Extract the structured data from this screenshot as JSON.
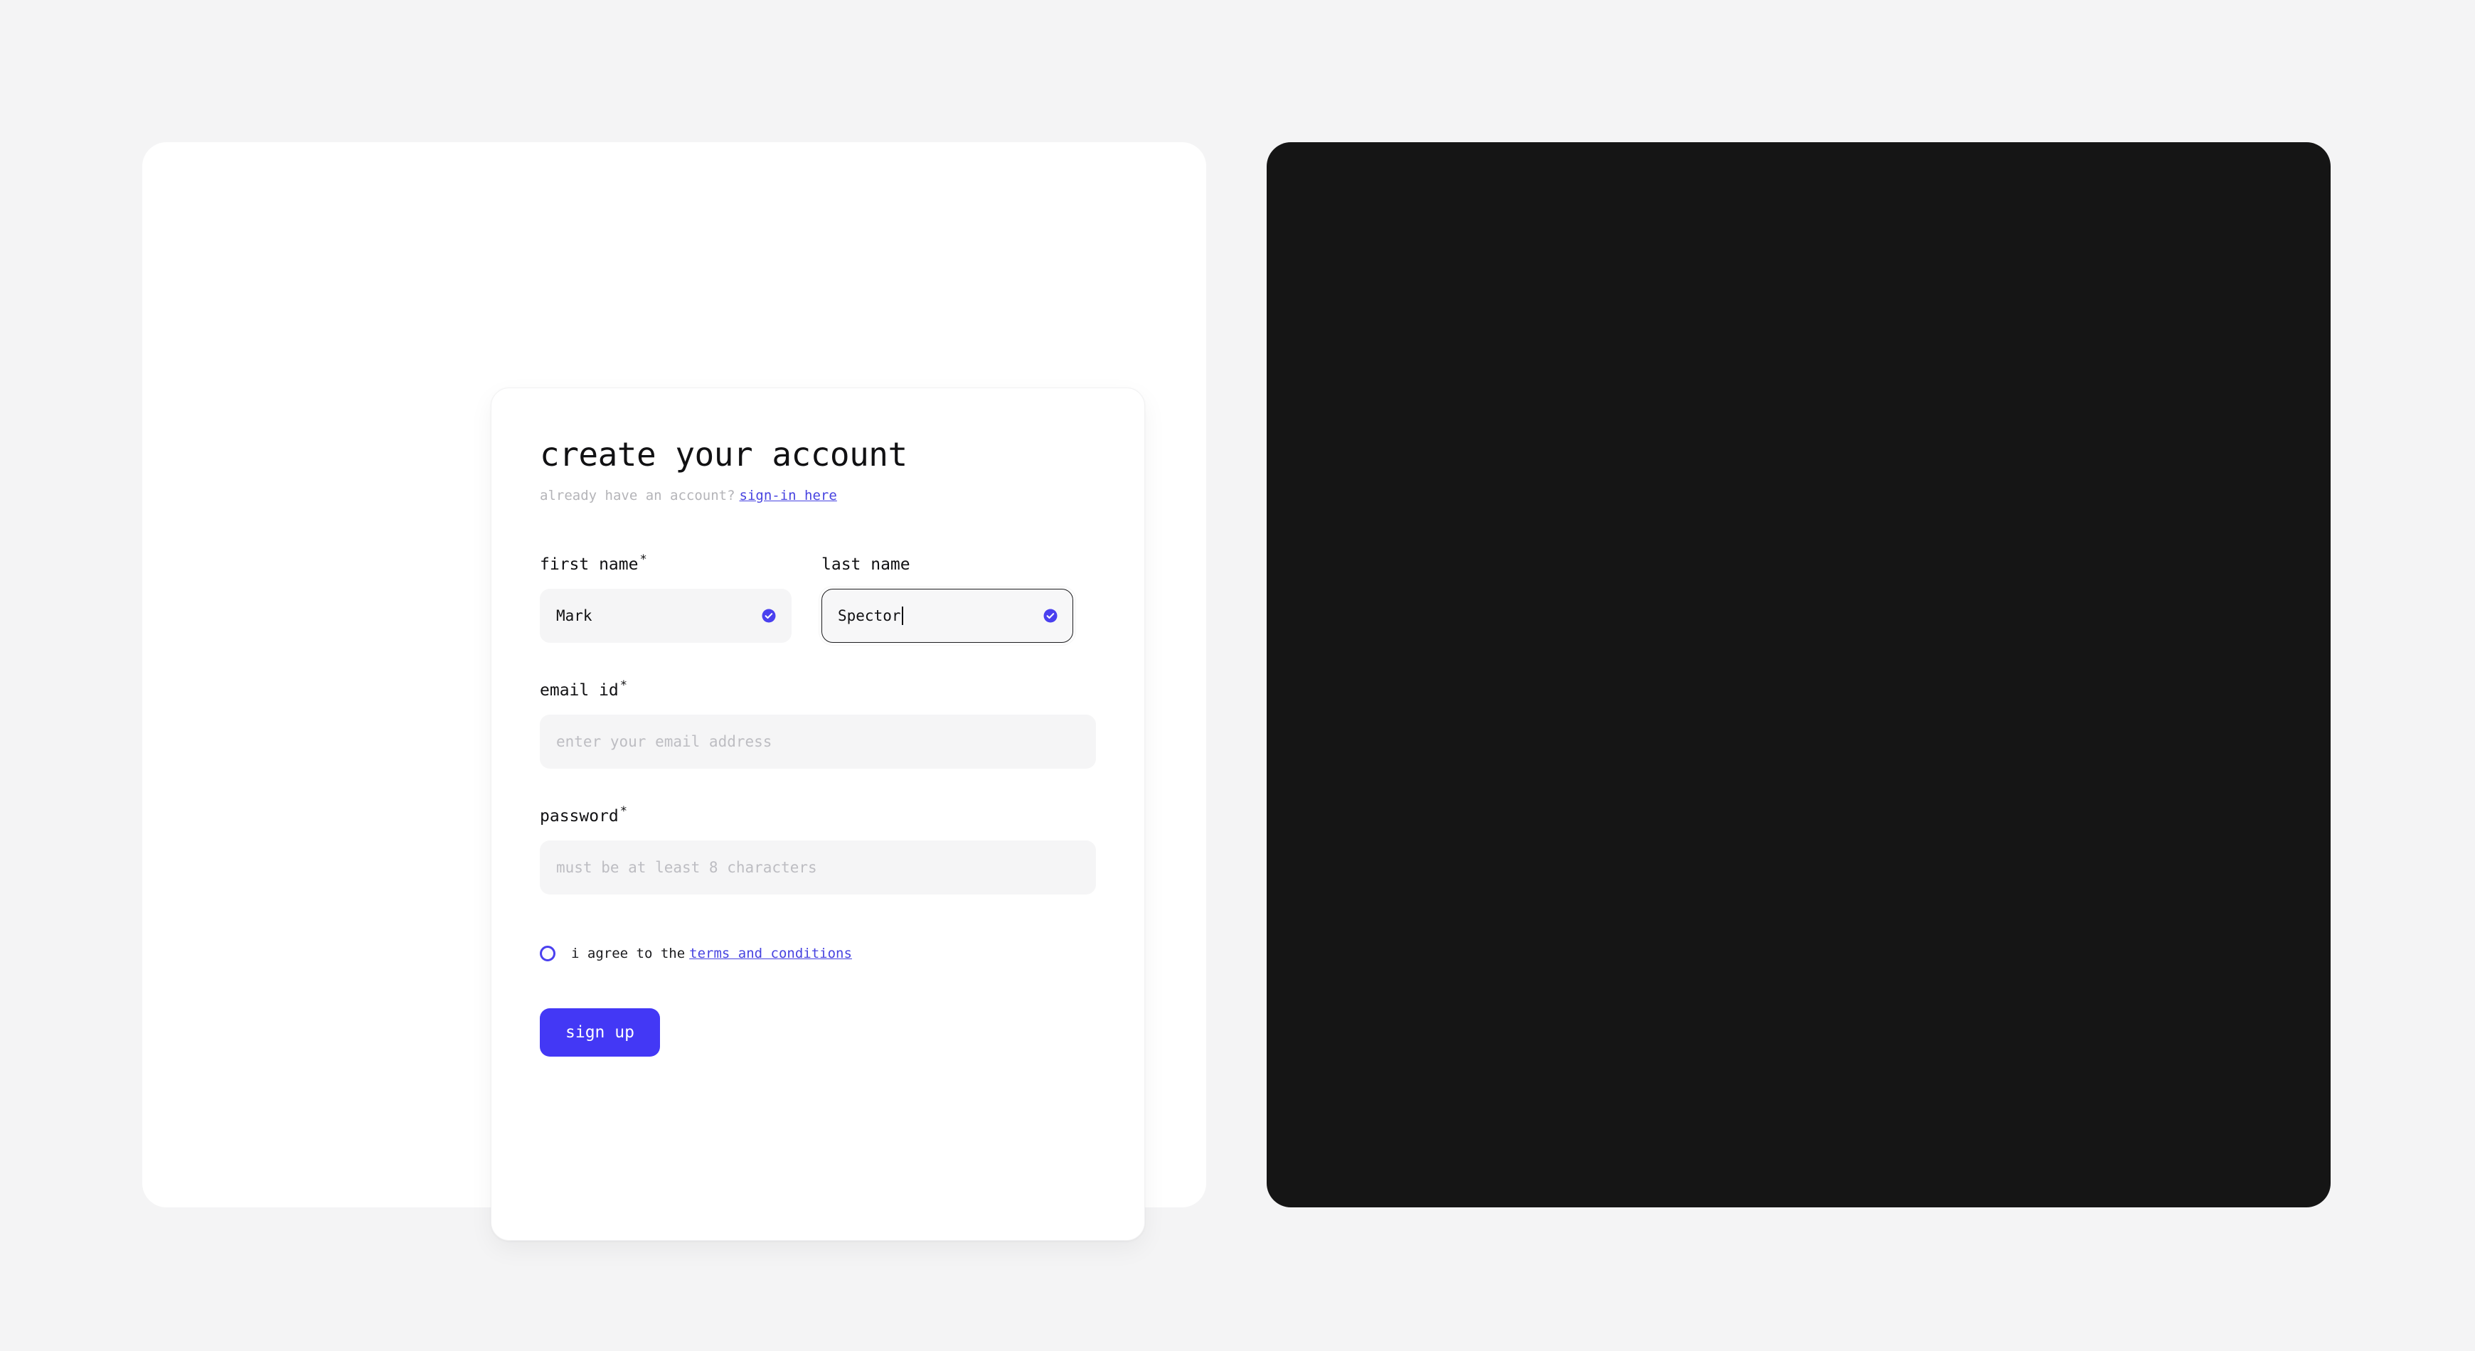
{
  "theme_colors": {
    "page_background": "#f4f4f5",
    "light_panel_background": "#ffffff",
    "dark_panel_background": "#151515",
    "light_card_background": "#ffffff",
    "dark_card_background": "#1a1a1a",
    "accent_indigo": "#4338f5",
    "link_indigo": "#4743e0",
    "valid_check": "#4a40ef"
  },
  "form": {
    "title": "create your account",
    "subline_text": "already have an account?",
    "subline_link": "sign-in here",
    "fields": {
      "first_name": {
        "label": "first name",
        "required_mark": "*",
        "value": "Mark",
        "placeholder": "",
        "state": "valid"
      },
      "last_name": {
        "label": "last name",
        "required_mark": "",
        "value": "Spector",
        "placeholder": "",
        "state": "valid-focused"
      },
      "email": {
        "label": "email id",
        "required_mark": "*",
        "value": "",
        "placeholder": "enter your email address",
        "state": "empty"
      },
      "password": {
        "label": "password",
        "required_mark": "*",
        "value": "",
        "placeholder": "must be at least 8 characters",
        "state": "empty"
      }
    },
    "agree": {
      "text": "i agree to the",
      "link": "terms and conditions",
      "checked": false
    },
    "submit_label": "sign up"
  }
}
